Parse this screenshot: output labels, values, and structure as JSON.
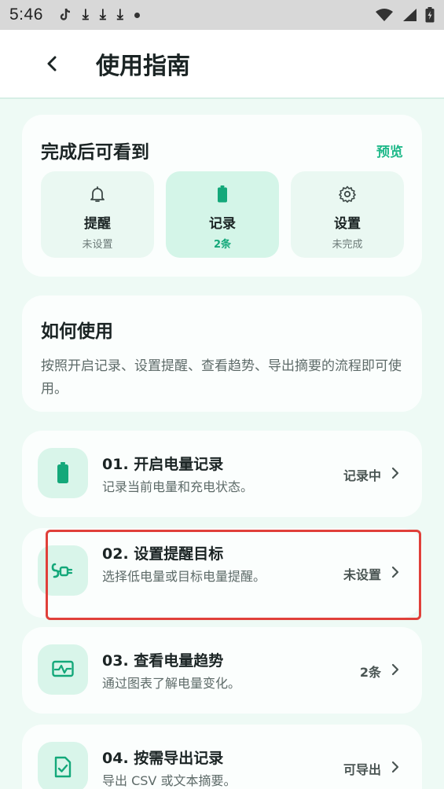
{
  "statusbar": {
    "time": "5:46",
    "download_glyph": "⤓"
  },
  "appbar": {
    "title": "使用指南"
  },
  "overview": {
    "title": "完成后可看到",
    "preview_label": "预览",
    "tiles": [
      {
        "icon": "bell-icon",
        "label": "提醒",
        "sub": "未设置"
      },
      {
        "icon": "battery-icon",
        "label": "记录",
        "sub": "2条"
      },
      {
        "icon": "gear-icon",
        "label": "设置",
        "sub": "未完成"
      }
    ]
  },
  "howto": {
    "title": "如何使用",
    "desc": "按照开启记录、设置提醒、查看趋势、导出摘要的流程即可使用。"
  },
  "steps": [
    {
      "icon": "battery-icon",
      "title": "01. 开启电量记录",
      "desc": "记录当前电量和充电状态。",
      "status": "记录中"
    },
    {
      "icon": "charging-plug-icon",
      "title": "02. 设置提醒目标",
      "desc": "选择低电量或目标电量提醒。",
      "status": "未设置"
    },
    {
      "icon": "trend-chart-icon",
      "title": "03. 查看电量趋势",
      "desc": "通过图表了解电量变化。",
      "status": "2条"
    },
    {
      "icon": "document-check-icon",
      "title": "04. 按需导出记录",
      "desc": "导出 CSV 或文本摘要。",
      "status": "可导出"
    }
  ],
  "colors": {
    "accent": "#20b98a",
    "highlight": "#e0403a",
    "background": "#eefaf5"
  }
}
